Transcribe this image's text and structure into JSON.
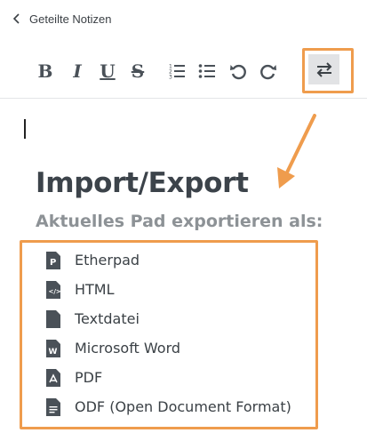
{
  "topbar": {
    "back_label": "Geteilte Notizen"
  },
  "toolbar": {
    "bold": "B",
    "italic": "I",
    "underline": "U",
    "strike": "S"
  },
  "pane": {
    "title": "Import/Export",
    "subtitle": "Aktuelles Pad exportieren als:"
  },
  "export_items": [
    {
      "label": "Etherpad",
      "icon": "etherpad-file-icon"
    },
    {
      "label": "HTML",
      "icon": "html-file-icon"
    },
    {
      "label": "Textdatei",
      "icon": "text-file-icon"
    },
    {
      "label": "Microsoft Word",
      "icon": "word-file-icon"
    },
    {
      "label": "PDF",
      "icon": "pdf-file-icon"
    },
    {
      "label": "ODF (Open Document Format)",
      "icon": "odf-file-icon"
    }
  ],
  "colors": {
    "highlight": "#ef9c4d",
    "text": "#3b4146",
    "subtitle": "#8d9296"
  }
}
